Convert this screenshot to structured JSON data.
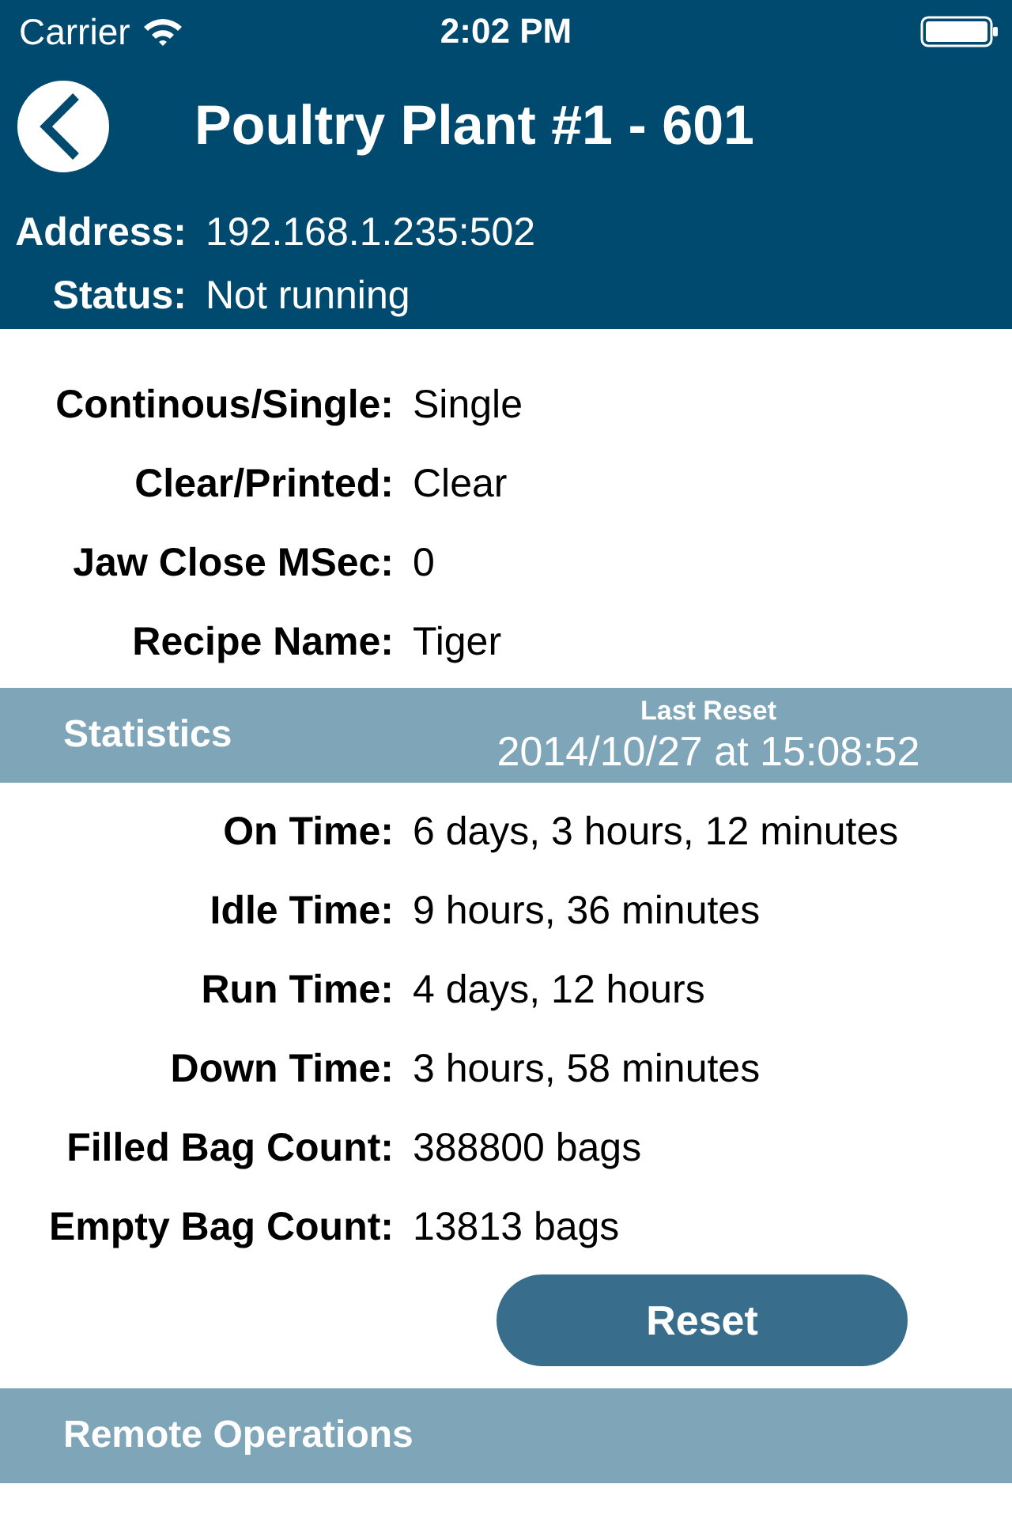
{
  "status_bar": {
    "carrier": "Carrier",
    "time": "2:02 PM"
  },
  "nav": {
    "title": "Poultry Plant #1 - 601"
  },
  "info": [
    {
      "label": "Address:",
      "value": "192.168.1.235:502"
    },
    {
      "label": "Status:",
      "value": "Not running"
    }
  ],
  "settings": [
    {
      "label": "Continous/Single:",
      "value": "Single"
    },
    {
      "label": "Clear/Printed:",
      "value": "Clear"
    },
    {
      "label": "Jaw Close MSec:",
      "value": "0"
    },
    {
      "label": "Recipe Name:",
      "value": "Tiger"
    }
  ],
  "statistics": {
    "title": "Statistics",
    "last_reset_label": "Last Reset",
    "last_reset": "2014/10/27 at 15:08:52",
    "rows": [
      {
        "label": "On Time:",
        "value": "6 days, 3 hours, 12 minutes"
      },
      {
        "label": "Idle Time:",
        "value": "9 hours, 36 minutes"
      },
      {
        "label": "Run Time:",
        "value": "4 days, 12 hours"
      },
      {
        "label": "Down Time:",
        "value": "3 hours, 58 minutes"
      },
      {
        "label": "Filled Bag Count:",
        "value": "388800 bags"
      },
      {
        "label": "Empty Bag Count:",
        "value": "13813 bags"
      }
    ],
    "button": "Reset"
  },
  "remote": {
    "title": "Remote Operations"
  }
}
